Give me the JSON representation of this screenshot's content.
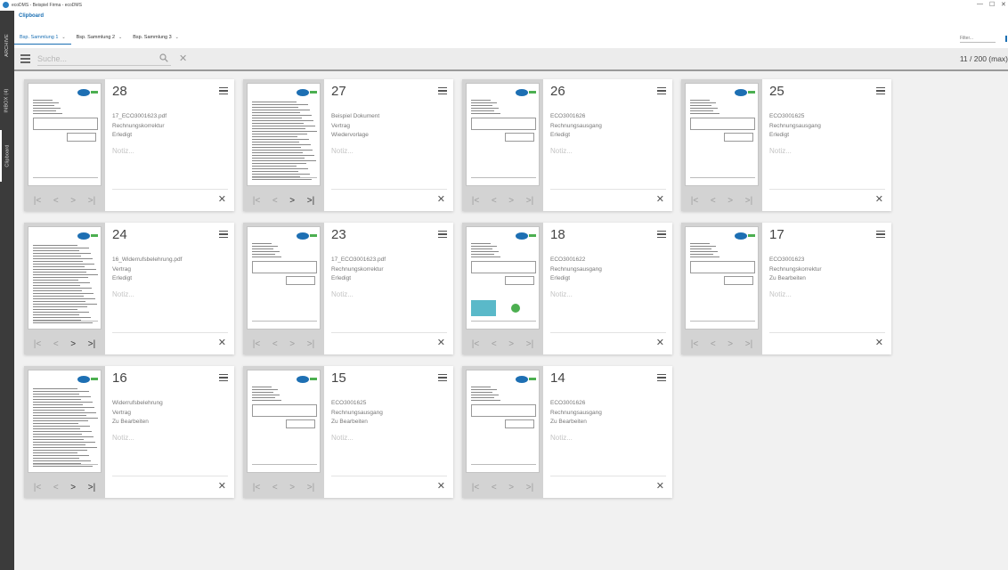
{
  "window": {
    "title": "ecoDMS - Beispiel Firma - ecoDMS",
    "min_icon": "—",
    "max_icon": "☐",
    "close_icon": "✕"
  },
  "sidebar": {
    "tabs": [
      {
        "label": "ARCHIVE"
      },
      {
        "label": "INBOX (4)"
      },
      {
        "label": "Clipboard"
      }
    ]
  },
  "clipboard": {
    "title": "Clipboard",
    "tabs": [
      {
        "label": "Bsp. Sammlung 1"
      },
      {
        "label": "Bsp. Sammlung 2"
      },
      {
        "label": "Bsp. Sammlung 3"
      }
    ],
    "tab_caret": "⌄",
    "filter_placeholder": "Filter...",
    "search_placeholder": "Suche...",
    "count": "11 / 200 (max)"
  },
  "nav_icons": {
    "first": "|<",
    "prev": "<",
    "next": ">",
    "last": ">|"
  },
  "close_glyph": "✕",
  "cards": [
    {
      "number": "28",
      "name": "17_ECO3001623.pdf",
      "type": "Rechnungskorrektur",
      "status": "Erledigt",
      "note": "Notiz...",
      "pages": 1
    },
    {
      "number": "27",
      "name": "Beispiel Dokument",
      "type": "Vertrag",
      "status": "Wiedervorlage",
      "note": "Notiz...",
      "pages": 2
    },
    {
      "number": "26",
      "name": "ECO3001626",
      "type": "Rechnungsausgang",
      "status": "Erledigt",
      "note": "Notiz...",
      "pages": 1
    },
    {
      "number": "25",
      "name": "ECO3001625",
      "type": "Rechnungsausgang",
      "status": "Erledigt",
      "note": "Notiz...",
      "pages": 1
    },
    {
      "number": "24",
      "name": "16_Widerrufsbelehrung.pdf",
      "type": "Vertrag",
      "status": "Erledigt",
      "note": "Notiz...",
      "pages": 2
    },
    {
      "number": "23",
      "name": "17_ECO3001623.pdf",
      "type": "Rechnungskorrektur",
      "status": "Erledigt",
      "note": "Notiz...",
      "pages": 1
    },
    {
      "number": "18",
      "name": "ECO3001622",
      "type": "Rechnungsausgang",
      "status": "Erledigt",
      "note": "Notiz...",
      "pages": 1
    },
    {
      "number": "17",
      "name": "ECO3001623",
      "type": "Rechnungskorrektur",
      "status": "Zu Bearbeiten",
      "note": "Notiz...",
      "pages": 1
    },
    {
      "number": "16",
      "name": "Widerrufsbelehrung",
      "type": "Vertrag",
      "status": "Zu Bearbeiten",
      "note": "Notiz...",
      "pages": 2
    },
    {
      "number": "15",
      "name": "ECO3001625",
      "type": "Rechnungsausgang",
      "status": "Zu Bearbeiten",
      "note": "Notiz...",
      "pages": 1
    },
    {
      "number": "14",
      "name": "ECO3001626",
      "type": "Rechnungsausgang",
      "status": "Zu Bearbeiten",
      "note": "Notiz...",
      "pages": 1
    }
  ]
}
